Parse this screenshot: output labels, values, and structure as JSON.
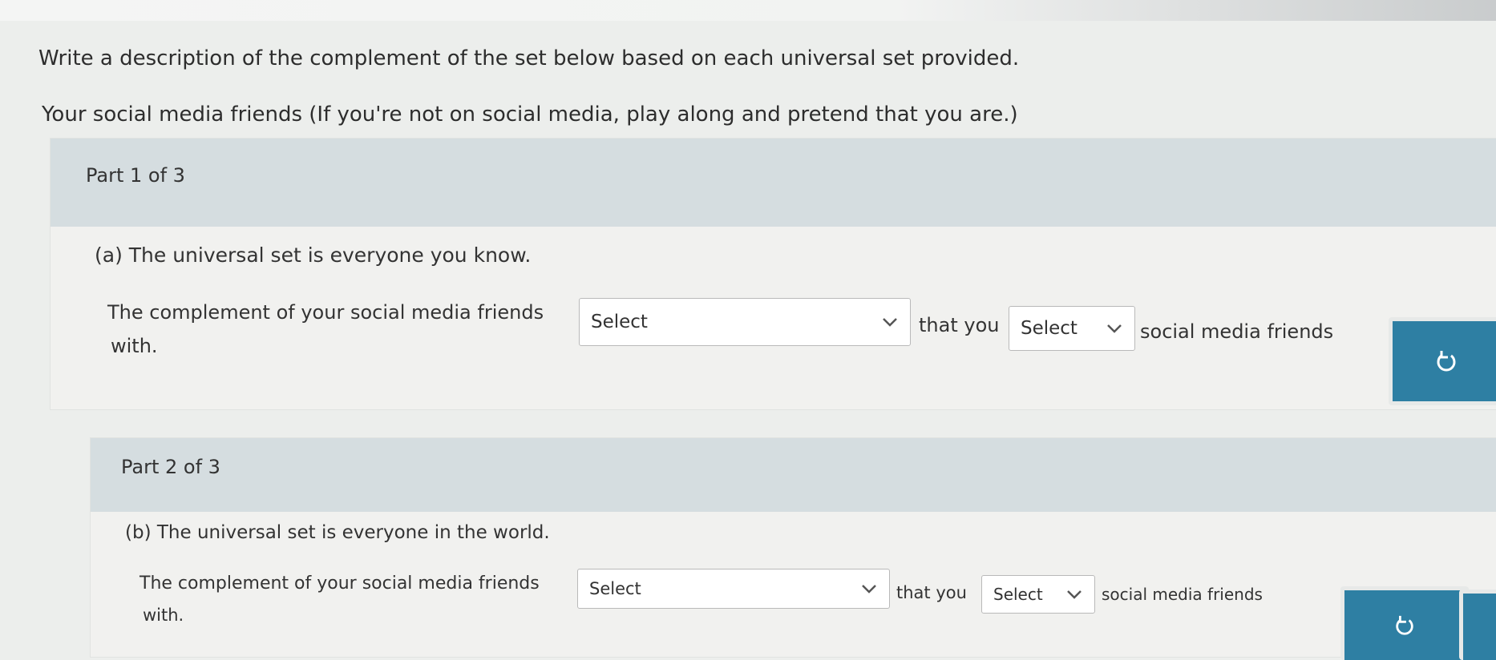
{
  "instructions": {
    "line1": "Write a description of the complement of the set below based on each universal set provided.",
    "line2": "Your social media friends (If you're not on social media, play along and pretend that you are.)"
  },
  "parts": [
    {
      "header": "Part 1 of 3",
      "subtitle": "(a) The universal set is everyone you know.",
      "sentence_start": "The complement of your social media friends",
      "select1_value": "Select",
      "middle": "that you",
      "select2_value": "Select",
      "sentence_end": "social media friends",
      "continuation": "with."
    },
    {
      "header": "Part 2 of 3",
      "subtitle": "(b) The universal set is everyone in the world.",
      "sentence_start": "The complement of your social media friends",
      "select1_value": "Select",
      "middle": "that you",
      "select2_value": "Select",
      "sentence_end": "social media friends",
      "continuation": "with."
    }
  ],
  "icons": {
    "reset": "reset-icon",
    "chevron": "chevron-down-icon"
  },
  "colors": {
    "header_bg": "#d5dde0",
    "button": "#2e7fa3"
  }
}
